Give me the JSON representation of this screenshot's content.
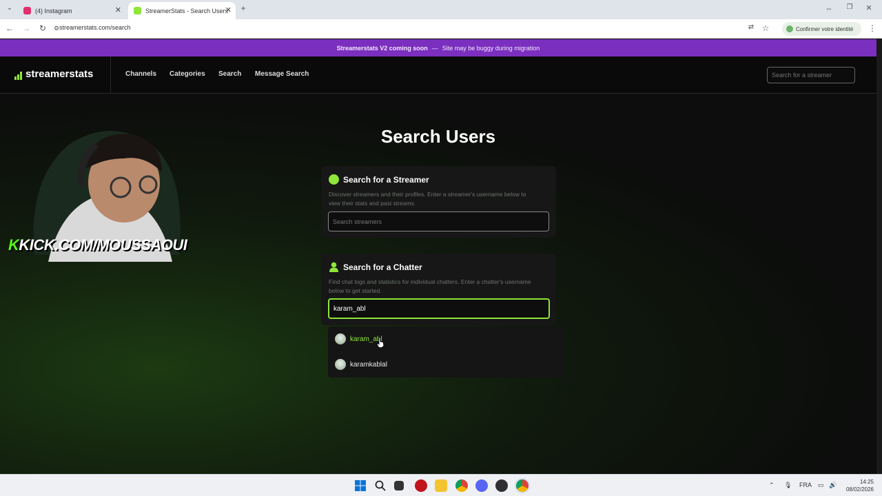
{
  "browser": {
    "tabs": [
      {
        "label": "(4) Instagram",
        "active": false,
        "favicon_color": "#e1306c"
      },
      {
        "label": "StreamerStats - Search Users",
        "active": true,
        "favicon_color": "#8ee63a"
      }
    ],
    "url": "streamerstats.com/search",
    "identity_button": "Confirmer votre identité"
  },
  "banner": {
    "bold": "Streamerstats V2 coming soon",
    "dash": "—",
    "text": "Site may be buggy during migration",
    "color": "#7b2fbe"
  },
  "site": {
    "logo": "streamerstats",
    "nav": [
      "Channels",
      "Categories",
      "Search",
      "Message Search"
    ],
    "search_placeholder": "Search for a streamer",
    "accent": "#8ee63a"
  },
  "overlay": {
    "kick_k": "K",
    "kick_text": "KICK.COM/MOUSSAOUI"
  },
  "page": {
    "title": "Search Users",
    "streamer_card": {
      "title": "Search for a Streamer",
      "description": "Discover streamers and their profiles. Enter a streamer's username below to view their stats and past streams.",
      "placeholder": "Search streamers",
      "icon": "green-dot-icon"
    },
    "chatter_card": {
      "title": "Search for a Chatter",
      "description": "Find chat logs and statistics for individual chatters. Enter a chatter's username below to get started.",
      "value": "karam_abl",
      "icon": "user-icon"
    },
    "suggestions": [
      {
        "name": "karam_abl",
        "highlighted": true
      },
      {
        "name": "karamkablal",
        "highlighted": false
      }
    ]
  },
  "taskbar": {
    "language": "FRA",
    "time": "14:25",
    "date": "08/02/2026"
  }
}
